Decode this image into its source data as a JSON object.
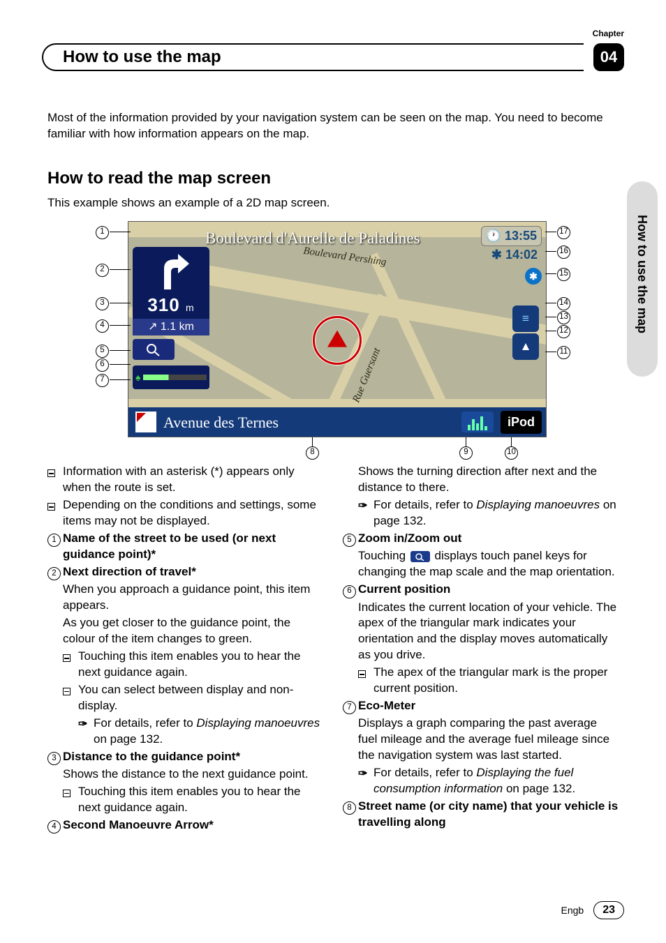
{
  "header": {
    "chapter_label": "Chapter",
    "title": "How to use the map",
    "chapter_num": "04"
  },
  "side_tab": "How to use the map",
  "intro": "Most of the information provided by your navigation system can be seen on the map. You need to become familiar with how information appears on the map.",
  "section_heading": "How to read the map screen",
  "section_sub": "This example shows an example of a 2D map screen.",
  "map": {
    "top_street": "Boulevard d'Aurelle de Paladines",
    "clock1": "13:55",
    "clock2": "14:02",
    "dist1_num": "310",
    "dist1_unit": "m",
    "dist2": "1.1 km",
    "road_label_1": "Boulevard Pershing",
    "road_label_2": "Rue Guersant",
    "bottom_street": "Avenue des Ternes",
    "ipod": "iPod",
    "callouts_left": [
      "1",
      "2",
      "3",
      "4",
      "5",
      "6",
      "7"
    ],
    "callouts_right": [
      "17",
      "16",
      "15",
      "14",
      "13",
      "12",
      "11"
    ],
    "callouts_bottom": [
      "8",
      "9",
      "10"
    ]
  },
  "left_col": {
    "bullet_a": "Information with an asterisk (*) appears only when the route is set.",
    "bullet_b": "Depending on the conditions and settings, some items may not be displayed.",
    "n1": "Name of the street to be used (or next guidance point)*",
    "n2_h": "Next direction of travel*",
    "n2_p1": "When you approach a guidance point, this item appears.",
    "n2_p2": "As you get closer to the guidance point, the colour of the item changes to green.",
    "n2_b1": "Touching this item enables you to hear the next guidance again.",
    "n2_b2": "You can select between display and non-display.",
    "n2_ref_a": "For details, refer to ",
    "n2_ref_i": "Displaying manoeuvres",
    "n2_ref_b": " on page 132.",
    "n3_h": "Distance to the guidance point*",
    "n3_p": "Shows the distance to the next guidance point.",
    "n3_b1": "Touching this item enables you to hear the next guidance again.",
    "n4_h": "Second Manoeuvre Arrow*"
  },
  "right_col": {
    "cont": "Shows the turning direction after next and the distance to there.",
    "cont_ref_a": "For details, refer to ",
    "cont_ref_i": "Displaying manoeuvres",
    "cont_ref_b": " on page 132.",
    "n5_h": "Zoom in/Zoom out",
    "n5_p_a": "Touching ",
    "n5_p_b": " displays touch panel keys for changing the map scale and the map orientation.",
    "n6_h": "Current position",
    "n6_p": "Indicates the current location of your vehicle. The apex of the triangular mark indicates your orientation and the display moves automatically as you drive.",
    "n6_b1": "The apex of the triangular mark is the proper current position.",
    "n7_h": "Eco-Meter",
    "n7_p": "Displays a graph comparing the past average fuel mileage and the average fuel mileage since the navigation system was last started.",
    "n7_ref_a": "For details, refer to ",
    "n7_ref_i": "Displaying the fuel consumption information",
    "n7_ref_b": " on page 132.",
    "n8_h": "Street name (or city name) that your vehicle is travelling along"
  },
  "footer": {
    "lang": "Engb",
    "page": "23"
  }
}
